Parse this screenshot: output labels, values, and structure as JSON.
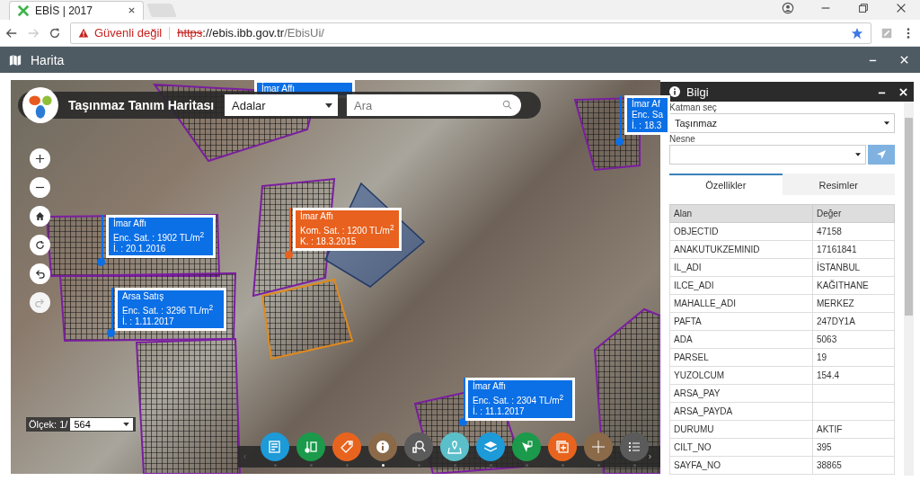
{
  "browser": {
    "tab": {
      "title": "EBİS | 2017"
    },
    "security": "Güvenli değil",
    "url": {
      "scheme": "https",
      "host": "://ebis.ibb.gov.tr",
      "path": "/EbisUi/"
    }
  },
  "app_header": {
    "title": "Harita"
  },
  "map": {
    "title": "Taşınmaz Tanım Haritası",
    "district": "Adalar",
    "search": {
      "placeholder": "Ara"
    },
    "callouts": [
      {
        "color": "#0b6fe6",
        "lines": [
          "İmar Affı"
        ]
      },
      {
        "color": "#0b6fe6",
        "lines": [
          "İmar Af",
          "Enc. Sa",
          "İ. : 18.3"
        ]
      },
      {
        "color": "#0b6fe6",
        "lines": [
          "İmar Affı",
          "Enc. Sat. : 1902 TL/m$^{2}$",
          "İ. : 20.1.2016"
        ]
      },
      {
        "color": "#0b6fe6",
        "lines": [
          "Arsa Satış",
          "Enc. Sat. : 3296 TL/m$^{2}$",
          "İ. : 1.11.2017"
        ]
      },
      {
        "color": "#e8611e",
        "lines": [
          "İmar Affı",
          "Kom. Sat. : 1200 TL/m$^{2}$",
          "K. : 18.3.2015"
        ]
      },
      {
        "color": "#0b6fe6",
        "lines": [
          "İmar Affı",
          "Enc. Sat. : 2304 TL/m$^{2}$",
          "İ. : 11.1.2017"
        ]
      }
    ],
    "zoom_controls": [
      {
        "kind": "plus",
        "disabled": false
      },
      {
        "kind": "minus",
        "disabled": false
      },
      {
        "kind": "home",
        "disabled": false
      },
      {
        "kind": "refresh",
        "disabled": false
      },
      {
        "kind": "undo",
        "disabled": false
      },
      {
        "kind": "redo",
        "disabled": true
      }
    ],
    "scale": {
      "label": "Ölçek: 1/",
      "value": "564"
    },
    "toolbar": [
      {
        "kind": "list",
        "color": "#1d9ad8",
        "selected": false
      },
      {
        "kind": "thermo",
        "color": "#1a9a4a",
        "selected": false
      },
      {
        "kind": "tag",
        "color": "#e8641e",
        "selected": false
      },
      {
        "kind": "info",
        "color": "#8b6a4a",
        "selected": true
      },
      {
        "kind": "search",
        "color": "#5b5b5b",
        "selected": false
      },
      {
        "kind": "pin",
        "color": "#5bbfc9",
        "selected": false
      },
      {
        "kind": "layers",
        "color": "#1d9ad8",
        "selected": false
      },
      {
        "kind": "pointer",
        "color": "#1a9a4a",
        "selected": false
      },
      {
        "kind": "add",
        "color": "#e8641e",
        "selected": false
      },
      {
        "kind": "cross",
        "color": "#8b6a4a",
        "selected": false
      },
      {
        "kind": "bullets",
        "color": "#5b5b5b",
        "selected": false
      }
    ]
  },
  "info_panel": {
    "title": "Bilgi",
    "layer_label": "Katman seç",
    "layer": "Taşınmaz",
    "object_label": "Nesne",
    "tabs": [
      {
        "label": "Özellikler",
        "selected": true
      },
      {
        "label": "Resimler",
        "selected": false
      }
    ],
    "columns": [
      "Alan",
      "Değer"
    ],
    "rows": [
      [
        "OBJECTID",
        "47158"
      ],
      [
        "ANAKUTUKZEMINID",
        "17161841"
      ],
      [
        "IL_ADI",
        "İSTANBUL"
      ],
      [
        "ILCE_ADI",
        "KAĞITHANE"
      ],
      [
        "MAHALLE_ADI",
        "MERKEZ"
      ],
      [
        "PAFTA",
        "247DY1A"
      ],
      [
        "ADA",
        "5063"
      ],
      [
        "PARSEL",
        "19"
      ],
      [
        "YUZOLCUM",
        "154.4"
      ],
      [
        "ARSA_PAY",
        ""
      ],
      [
        "ARSA_PAYDA",
        ""
      ],
      [
        "DURUMU",
        "AKTIF"
      ],
      [
        "CILT_NO",
        "395"
      ],
      [
        "SAYFA_NO",
        "38865"
      ]
    ]
  }
}
